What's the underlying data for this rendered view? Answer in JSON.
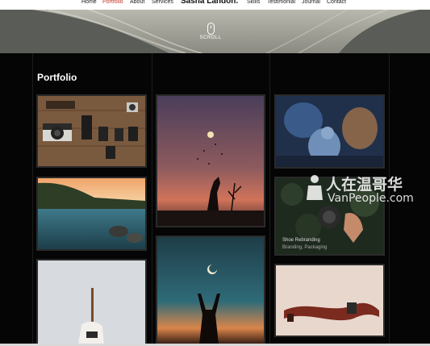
{
  "nav": {
    "left": [
      "Home",
      "Portfolio",
      "About",
      "Services"
    ],
    "brand": "Sasha Landon.",
    "right": [
      "Skills",
      "Testimonial",
      "Journal",
      "Contact"
    ]
  },
  "hero": {
    "scroll_label": "SCROLL"
  },
  "portfolio": {
    "title": "Portfolio",
    "items": [
      {
        "subject": "cameras and lenses"
      },
      {
        "subject": "lake at sunset"
      },
      {
        "subject": "hand holding pen"
      },
      {
        "subject": "silhouette with lanterns"
      },
      {
        "subject": "silhouette reaching for moon"
      },
      {
        "subject": "pigeon sculpture"
      },
      {
        "subject": "hand holding lens",
        "caption": "Shoe Rebranding",
        "subcaption": "Branding, Packaging"
      },
      {
        "subject": "film roll"
      }
    ]
  },
  "watermark": {
    "cn": "人在温哥华",
    "en": "VanPeople.com"
  }
}
